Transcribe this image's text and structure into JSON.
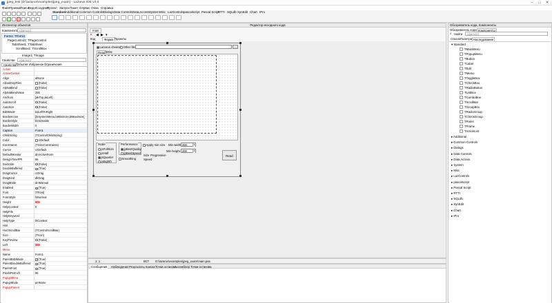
{
  "window": {
    "title": "jpeg_test (D:\\lazarus\\examples\\jpeg_exam) - Lazarus IDE v4.0"
  },
  "menu": [
    "Файл",
    "Правка",
    "Поиск",
    "Вид",
    "Исходник",
    "Проект",
    "Запуск",
    "Пакет",
    "Сервис",
    "Окна",
    "Справка"
  ],
  "palette_tabs": [
    "Standard",
    "Additional",
    "Common Controls",
    "Dialogs",
    "Data Controls",
    "Data Access",
    "System",
    "Misc",
    "LazControls",
    "pascalscript",
    "Pascal Script",
    "RTTI",
    "SQLdb",
    "SynEdit",
    "Chart",
    "IPro"
  ],
  "inspector": {
    "title": "Инспектор объектов",
    "components_label": "Компоненты",
    "components_filter": "(фильтр)",
    "tree": [
      "Form1: TForm1",
      "PageControl1: TPageControl",
      "TabSheet1: TTabSheet",
      "ScrollBox1: TScrollBox",
      "Image1: TImage"
    ],
    "props_label": "Свойства",
    "props_filter": "(фильтр)",
    "tabs": [
      "Свойства",
      "События",
      "Избранное",
      "Ограничения"
    ]
  },
  "properties": [
    {
      "n": "Action",
      "v": "",
      "red": true
    },
    {
      "n": "ActiveControl",
      "v": "",
      "red": true
    },
    {
      "n": "Align",
      "v": "alNone"
    },
    {
      "n": "AllowDropFiles",
      "v": "(False)",
      "cb": "off"
    },
    {
      "n": "AlphaBlend",
      "v": "(False)",
      "cb": "off"
    },
    {
      "n": "AlphaBlendValue",
      "v": "255"
    },
    {
      "n": "Anchors",
      "v": "[akTop,akLeft]"
    },
    {
      "n": "AutoScroll",
      "v": "(False)",
      "cb": "off"
    },
    {
      "n": "AutoSize",
      "v": "(False)",
      "cb": "off"
    },
    {
      "n": "BiDiMode",
      "v": "bdLeftToRight"
    },
    {
      "n": "BorderIcons",
      "v": "[biSystemMenu,biMinimize,biMaximize]"
    },
    {
      "n": "BorderStyle",
      "v": "bsSizeable"
    },
    {
      "n": "BorderWidth",
      "v": "0"
    },
    {
      "n": "Caption",
      "v": "Form1"
    },
    {
      "n": "ChildSizing",
      "v": "(TControlChildSizing)"
    },
    {
      "n": "Color",
      "v": "clDefault",
      "sw": "#ffffff"
    },
    {
      "n": "Constraints",
      "v": "(TSizeConstraints)"
    },
    {
      "n": "Cursor",
      "v": "crDefault"
    },
    {
      "n": "DefaultMonitor",
      "v": "dmActiveForm"
    },
    {
      "n": "DesignTimePPI",
      "v": "96"
    },
    {
      "n": "DockSite",
      "v": "(False)",
      "cb": "off"
    },
    {
      "n": "DoubleBuffered",
      "v": "(True)",
      "cb": "on"
    },
    {
      "n": "DragCursor",
      "v": "crDrag"
    },
    {
      "n": "DragKind",
      "v": "dkDrag"
    },
    {
      "n": "DragMode",
      "v": "dmManual"
    },
    {
      "n": "Enabled",
      "v": "(True)",
      "cb": "on"
    },
    {
      "n": "Font",
      "v": "(TFont)"
    },
    {
      "n": "FormStyle",
      "v": "fsNormal"
    },
    {
      "n": "Height",
      "v": "609",
      "bold": true
    },
    {
      "n": "HelpContext",
      "v": "0"
    },
    {
      "n": "HelpFile",
      "v": ""
    },
    {
      "n": "HelpKeyword",
      "v": ""
    },
    {
      "n": "HelpType",
      "v": "htContext"
    },
    {
      "n": "Hint",
      "v": ""
    },
    {
      "n": "HorzScrollBar",
      "v": "(TControlScrollBar)"
    },
    {
      "n": "Icon",
      "v": "(TIcon)"
    },
    {
      "n": "KeyPreview",
      "v": "(False)",
      "cb": "off"
    },
    {
      "n": "Left",
      "v": "348",
      "bold": true
    },
    {
      "n": "Menu",
      "v": "",
      "red": true
    },
    {
      "n": "Name",
      "v": "Form1"
    },
    {
      "n": "ParentBiDiMode",
      "v": "(True)",
      "cb": "on"
    },
    {
      "n": "ParentDoubleBuffered",
      "v": "(True)",
      "cb": "on"
    },
    {
      "n": "ParentFont",
      "v": "(True)",
      "cb": "on"
    },
    {
      "n": "PixelsPerInch",
      "v": "96"
    },
    {
      "n": "PopupMenu",
      "v": "",
      "red": true
    },
    {
      "n": "PopupMode",
      "v": "pmNone"
    },
    {
      "n": "PopupParent",
      "v": "",
      "red": true
    }
  ],
  "editor": {
    "title": "Редактор исходного кода",
    "tab": "main",
    "status_pos": "1: 1",
    "status_ins": "ВСТ",
    "status_file": "D:\\lazarus\\examples\\jpeg_exam\\main.pas"
  },
  "designer": {
    "tabs": [
      "Код",
      "Форма",
      "Проекты"
    ],
    "radio_lazarus": "Lazarus cheetah",
    "radio_other": "Other file",
    "inner_tabs": [
      "Read",
      "Write"
    ],
    "scale_label": "Scale",
    "scale_opts": [
      "jsFullSize",
      "jsHalf",
      "jsQuarter",
      "jsEighth"
    ],
    "perf_label": "Performance",
    "perf_opts": [
      "jpBestQuality",
      "jpBestSpeed"
    ],
    "apply_min": "Apply min size",
    "min_width": "Min width",
    "min_width_val": "200",
    "min_height": "Min height",
    "min_height_val": "200",
    "smoothing": "Smoothing",
    "size_label": "Size",
    "speed_label": "Speed",
    "progressive": "Progressive",
    "read_btn": "Read"
  },
  "messages": {
    "tabs": [
      "Сообщения",
      "Наблюдение",
      "Результаты поиска",
      "Точки останова",
      "Ассемблер",
      "Точки останова"
    ]
  },
  "right": {
    "title1": "Обозреватель кода",
    "title2": "Обозреватель кода, Компоненты",
    "tab1": "Обозреватель кода",
    "tab2": "Компоненты",
    "find_label": "Найти",
    "find_filter": "(фильтр)",
    "subtabs": [
      "Список",
      "Палитра",
      "Наследование"
    ],
    "standard": "Standard",
    "items": [
      "TMainMenu",
      "TPopupMenu",
      "TButton",
      "TLabel",
      "TEdit",
      "TMemo",
      "TToggleBox",
      "TCheckBox",
      "TRadioButton",
      "TListBox",
      "TComboBox",
      "TScrollBar",
      "TGroupBox",
      "TRadioGroup",
      "TCheckGroup",
      "TPanel",
      "TFrame",
      "TActionList"
    ],
    "cats": [
      "Additional",
      "Common Controls",
      "Dialogs",
      "Data Controls",
      "Data Access",
      "System",
      "Misc",
      "LazControls",
      "pascalscript",
      "Pascal Script",
      "RTTI",
      "SQLdb",
      "SynEdit",
      "Chart",
      "IPro"
    ]
  }
}
